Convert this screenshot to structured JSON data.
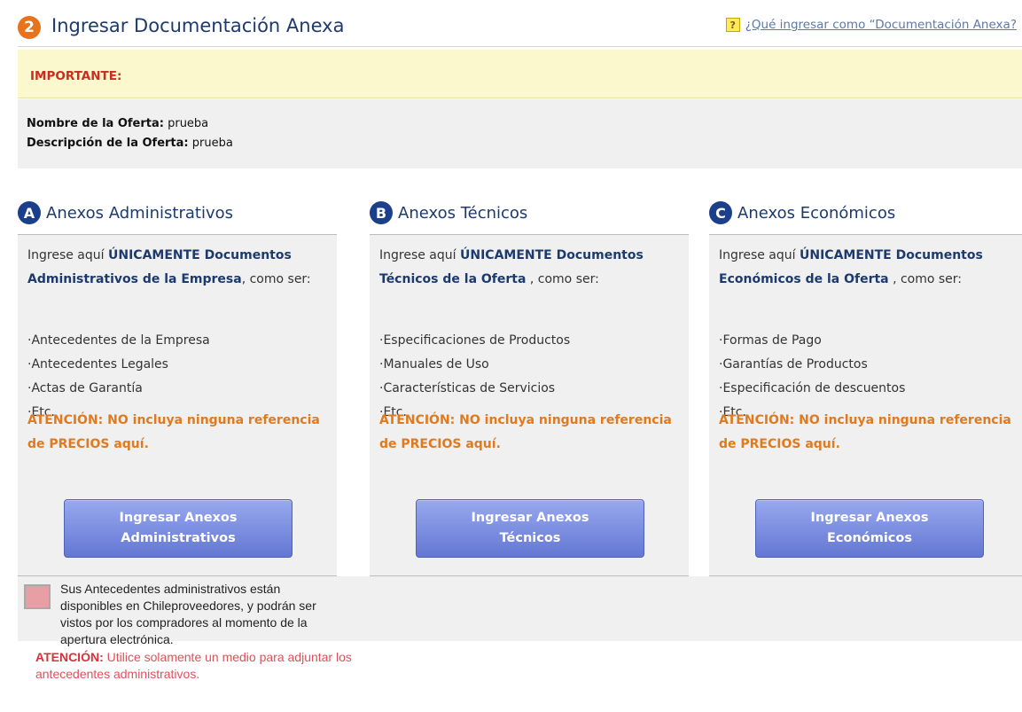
{
  "header": {
    "step_number": "2",
    "title": "Ingresar Documentación Anexa",
    "help_icon_glyph": "?",
    "help_link": "¿Qué ingresar como “Documentación Anexa?"
  },
  "important": {
    "label": "IMPORTANTE:"
  },
  "offer": {
    "name_label": "Nombre de la Oferta:",
    "name_value": "prueba",
    "description_label": "Descripción de la Oferta:",
    "description_value": "prueba"
  },
  "columns": [
    {
      "badge": "A",
      "title": "Anexos Administrativos",
      "intro_prefix": "Ingrese aquí ",
      "intro_strong": "ÚNICAMENTE Documentos Administrativos de la Empresa",
      "intro_suffix": ", como ser:",
      "items": [
        "·Antecedentes de la Empresa",
        "·Antecedentes Legales",
        "·Actas de Garantía",
        "·Etc."
      ],
      "warning": "ATENCIÓN: NO incluya ninguna referencia de PRECIOS aquí.",
      "button_line1": "Ingresar Anexos",
      "button_line2": "Administrativos"
    },
    {
      "badge": "B",
      "title": "Anexos Técnicos",
      "intro_prefix": "Ingrese aquí ",
      "intro_strong": "ÚNICAMENTE Documentos Técnicos de la Oferta",
      "intro_suffix": " , como ser:",
      "items": [
        "·Especificaciones de Productos",
        "·Manuales de Uso",
        "·Características de Servicios",
        "·Etc."
      ],
      "warning": "ATENCIÓN: NO incluya ninguna referencia de PRECIOS aquí.",
      "button_line1": "Ingresar Anexos",
      "button_line2": "Técnicos"
    },
    {
      "badge": "C",
      "title": "Anexos Económicos",
      "intro_prefix": "Ingrese aquí ",
      "intro_strong": "ÚNICAMENTE Documentos Económicos de la Oferta",
      "intro_suffix": " , como ser:",
      "items": [
        "·Formas de Pago",
        "·Garantías de Productos",
        "·Especificación de descuentos",
        "·Etc."
      ],
      "warning": "ATENCIÓN: NO incluya ninguna referencia de PRECIOS aquí.",
      "button_line1": "Ingresar Anexos",
      "button_line2": "Económicos"
    }
  ],
  "admin_notice": {
    "text": "Sus Antecedentes administrativos están disponibles en Chileproveedores, y podrán ser vistos por los compradores al momento de la apertura electrónica.",
    "warning_label": "ATENCIÓN:",
    "warning_text": " Utilice solamente un medio para adjuntar los antecedentes administrativos."
  },
  "colors": {
    "title_blue": "#1d3a6e",
    "step_orange": "#e8731a",
    "badge_navy": "#1c3f8c",
    "important_red": "#cc2b1f",
    "warning_orange": "#e07a1e",
    "button_blue": "#6377d3",
    "notice_pink": "#e89ea5"
  }
}
